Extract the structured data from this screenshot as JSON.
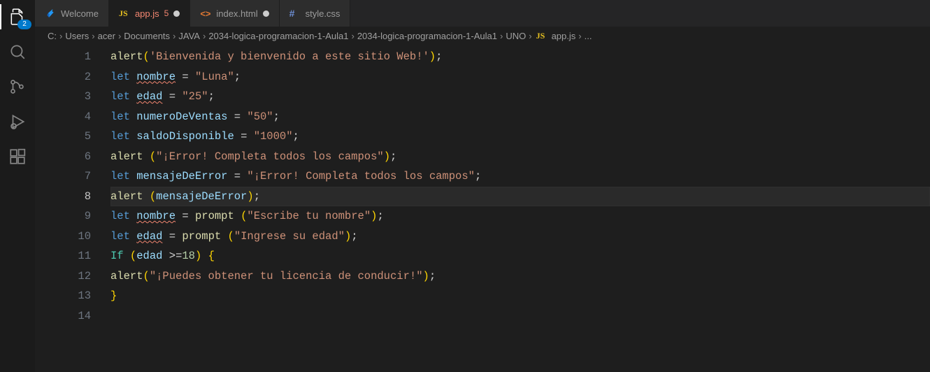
{
  "activity": {
    "explorer_badge": "2"
  },
  "tabs": [
    {
      "kind": "welcome",
      "label": "Welcome",
      "active": false,
      "dirty": false
    },
    {
      "kind": "js",
      "label": "app.js",
      "active": true,
      "dirty": true,
      "problems": "5"
    },
    {
      "kind": "html",
      "label": "index.html",
      "active": false,
      "dirty": true
    },
    {
      "kind": "css",
      "label": "style.css",
      "active": false,
      "dirty": false
    }
  ],
  "breadcrumbs": {
    "segments": [
      "C:",
      "Users",
      "acer",
      "Documents",
      "JAVA",
      "2034-logica-programacion-1-Aula1",
      "2034-logica-programacion-1-Aula1",
      "UNO"
    ],
    "file_kind": "js",
    "file": "app.js",
    "trailing_ellipsis": "..."
  },
  "code": {
    "active_line_index": 7,
    "lines": [
      [
        {
          "t": "fn",
          "v": "alert"
        },
        {
          "t": "br1",
          "v": "("
        },
        {
          "t": "str",
          "v": "'Bienvenida y bienvenido a este sitio Web!'"
        },
        {
          "t": "br1",
          "v": ")"
        },
        {
          "t": "pn",
          "v": ";"
        }
      ],
      [
        {
          "t": "kw",
          "v": "let"
        },
        {
          "t": "pn",
          "v": " "
        },
        {
          "t": "id",
          "v": "nombre",
          "sq": true
        },
        {
          "t": "pn",
          "v": " "
        },
        {
          "t": "op",
          "v": "="
        },
        {
          "t": "pn",
          "v": " "
        },
        {
          "t": "str",
          "v": "\"Luna\""
        },
        {
          "t": "pn",
          "v": ";"
        }
      ],
      [
        {
          "t": "kw",
          "v": "let"
        },
        {
          "t": "pn",
          "v": " "
        },
        {
          "t": "id",
          "v": "edad",
          "sq": true
        },
        {
          "t": "pn",
          "v": " "
        },
        {
          "t": "op",
          "v": "="
        },
        {
          "t": "pn",
          "v": " "
        },
        {
          "t": "str",
          "v": "\"25\""
        },
        {
          "t": "pn",
          "v": ";"
        }
      ],
      [
        {
          "t": "kw",
          "v": "let"
        },
        {
          "t": "pn",
          "v": " "
        },
        {
          "t": "id",
          "v": "numeroDeVentas"
        },
        {
          "t": "pn",
          "v": " "
        },
        {
          "t": "op",
          "v": "="
        },
        {
          "t": "pn",
          "v": " "
        },
        {
          "t": "str",
          "v": "\"50\""
        },
        {
          "t": "pn",
          "v": ";"
        }
      ],
      [
        {
          "t": "kw",
          "v": "let"
        },
        {
          "t": "pn",
          "v": " "
        },
        {
          "t": "id",
          "v": "saldoDisponible"
        },
        {
          "t": "pn",
          "v": " "
        },
        {
          "t": "op",
          "v": "="
        },
        {
          "t": "pn",
          "v": " "
        },
        {
          "t": "str",
          "v": "\"1000\""
        },
        {
          "t": "pn",
          "v": ";"
        }
      ],
      [
        {
          "t": "fn",
          "v": "alert"
        },
        {
          "t": "pn",
          "v": " "
        },
        {
          "t": "br1",
          "v": "("
        },
        {
          "t": "str",
          "v": "\"¡Error! Completa todos los campos\""
        },
        {
          "t": "br1",
          "v": ")"
        },
        {
          "t": "pn",
          "v": ";"
        }
      ],
      [
        {
          "t": "kw",
          "v": "let"
        },
        {
          "t": "pn",
          "v": " "
        },
        {
          "t": "id",
          "v": "mensajeDeError"
        },
        {
          "t": "pn",
          "v": " "
        },
        {
          "t": "op",
          "v": "="
        },
        {
          "t": "pn",
          "v": " "
        },
        {
          "t": "str",
          "v": "\"¡Error! Completa todos los campos\""
        },
        {
          "t": "pn",
          "v": ";"
        }
      ],
      [
        {
          "t": "fn",
          "v": "alert"
        },
        {
          "t": "pn",
          "v": " "
        },
        {
          "t": "br1",
          "v": "("
        },
        {
          "t": "id",
          "v": "mensajeDeError"
        },
        {
          "t": "br1",
          "v": ")"
        },
        {
          "t": "pn",
          "v": ";"
        }
      ],
      [
        {
          "t": "kw",
          "v": "let"
        },
        {
          "t": "pn",
          "v": " "
        },
        {
          "t": "id",
          "v": "nombre",
          "sq": true
        },
        {
          "t": "pn",
          "v": " "
        },
        {
          "t": "op",
          "v": "="
        },
        {
          "t": "pn",
          "v": " "
        },
        {
          "t": "fn",
          "v": "prompt"
        },
        {
          "t": "pn",
          "v": " "
        },
        {
          "t": "br1",
          "v": "("
        },
        {
          "t": "str",
          "v": "\"Escribe tu nombre\""
        },
        {
          "t": "br1",
          "v": ")"
        },
        {
          "t": "pn",
          "v": ";"
        }
      ],
      [
        {
          "t": "kw",
          "v": "let"
        },
        {
          "t": "pn",
          "v": " "
        },
        {
          "t": "id",
          "v": "edad",
          "sq": true
        },
        {
          "t": "pn",
          "v": " "
        },
        {
          "t": "op",
          "v": "="
        },
        {
          "t": "pn",
          "v": " "
        },
        {
          "t": "fn",
          "v": "prompt"
        },
        {
          "t": "pn",
          "v": " "
        },
        {
          "t": "br1",
          "v": "("
        },
        {
          "t": "str",
          "v": "\"Ingrese su edad\""
        },
        {
          "t": "br1",
          "v": ")"
        },
        {
          "t": "pn",
          "v": ";"
        }
      ],
      [
        {
          "t": "cap",
          "v": "If"
        },
        {
          "t": "pn",
          "v": " "
        },
        {
          "t": "br1",
          "v": "("
        },
        {
          "t": "id",
          "v": "edad"
        },
        {
          "t": "pn",
          "v": " "
        },
        {
          "t": "op",
          "v": ">="
        },
        {
          "t": "num",
          "v": "18"
        },
        {
          "t": "br1",
          "v": ")"
        },
        {
          "t": "pn",
          "v": " "
        },
        {
          "t": "br1",
          "v": "{"
        }
      ],
      [
        {
          "t": "fn",
          "v": "alert"
        },
        {
          "t": "br1",
          "v": "("
        },
        {
          "t": "str",
          "v": "\"¡Puedes obtener tu licencia de conducir!\""
        },
        {
          "t": "br1",
          "v": ")"
        },
        {
          "t": "pn",
          "v": ";"
        }
      ],
      [
        {
          "t": "br1",
          "v": "}"
        }
      ],
      []
    ]
  }
}
